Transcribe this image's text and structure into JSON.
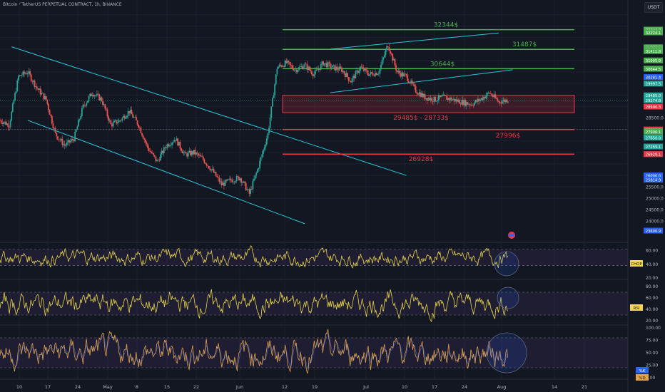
{
  "header": {
    "title": "Bitcoin / TetherUS PERPETUAL CONTRACT, 1h, BINANCE",
    "currency_button": "USDT"
  },
  "colors": {
    "background": "#131722",
    "green_level": "#4caf50",
    "red_level": "#f23645",
    "channel": "#26c6da",
    "indicator_line": "#e6d44a",
    "axis_text": "#b2b5be"
  },
  "chart_data": [
    {
      "type": "line",
      "panel": "price",
      "price_axis": {
        "ylim": [
          23400,
          33200
        ],
        "ticks": [
          25000,
          25500,
          26000,
          26500,
          27000,
          27500,
          28000,
          28500,
          29000,
          29500,
          30000,
          30500,
          31000,
          31500,
          32000,
          32500,
          33000
        ],
        "tick_labels_shown": [
          "28500.0",
          "25500.0",
          "25000.0",
          "24500.0",
          "24000.0"
        ]
      },
      "price_tags": [
        {
          "value": "32344.7",
          "color": "#4caf50"
        },
        {
          "value": "32344.7",
          "color": "#4caf50"
        },
        {
          "value": "32224.1",
          "color": "#4caf50"
        },
        {
          "value": "31577.3",
          "color": "#4caf50"
        },
        {
          "value": "31487.0",
          "color": "#4caf50"
        },
        {
          "value": "31487.0",
          "color": "#4caf50"
        },
        {
          "value": "31411.8",
          "color": "#4caf50"
        },
        {
          "value": "31005.9",
          "color": "#4caf50"
        },
        {
          "value": "30644.5",
          "color": "#4caf50"
        },
        {
          "value": "30644.5",
          "color": "#4caf50"
        },
        {
          "value": "30281.4",
          "color": "#2962ff"
        },
        {
          "value": "29997.5",
          "color": "#26a69a"
        },
        {
          "value": "29485.0",
          "color": "#26a69a"
        },
        {
          "value": "29274.8",
          "color": "#26a69a"
        },
        {
          "value": "28996.3",
          "color": "#f23645"
        },
        {
          "value": "27996.3",
          "color": "#f23645"
        },
        {
          "value": "27996.3",
          "color": "#f23645"
        },
        {
          "value": "27921.1",
          "color": "#4caf50"
        },
        {
          "value": "27906.1",
          "color": "#4caf50"
        },
        {
          "value": "27650.0",
          "color": "#26a69a"
        },
        {
          "value": "27259.1",
          "color": "#26a69a"
        },
        {
          "value": "26928.1",
          "color": "#f23645"
        },
        {
          "value": "26928.1",
          "color": "#f23645"
        },
        {
          "value": "26000.0",
          "color": "#2962ff"
        },
        {
          "value": "25814.9",
          "color": "#2962ff"
        },
        {
          "value": "23600.9",
          "color": "#2962ff"
        }
      ],
      "levels": [
        {
          "price": 32344,
          "label": "32344$",
          "color": "#4caf50"
        },
        {
          "price": 31487,
          "label": "31487$",
          "color": "#4caf50"
        },
        {
          "price": 30644,
          "label": "30644$",
          "color": "#4caf50"
        },
        {
          "price": 27996,
          "label": "27996$",
          "color": "#f23645"
        },
        {
          "price": 26928,
          "label": "26928$",
          "color": "#f23645"
        }
      ],
      "zone": {
        "high": 29485,
        "low": 28733,
        "label": "29485$ - 28733$"
      },
      "x_axis": {
        "labels": [
          "10",
          "17",
          "24",
          "May",
          "8",
          "15",
          "22",
          "Jun",
          "12",
          "19",
          "Jul",
          "10",
          "17",
          "24",
          "Aug",
          "14",
          "21"
        ]
      },
      "series": [
        {
          "x": [
            0,
            4,
            8,
            12,
            16,
            20,
            24,
            28,
            32,
            36,
            40,
            44,
            48,
            52,
            56,
            60,
            64,
            68,
            72,
            76,
            80,
            84,
            88,
            92,
            96,
            100,
            104,
            108,
            112,
            116,
            120,
            124
          ],
          "values": [
            28400,
            28200,
            30300,
            30500,
            29800,
            29300,
            27800,
            27300,
            27600,
            29000,
            29600,
            29300,
            28200,
            28400,
            28800,
            28200,
            27200,
            26600,
            27300,
            27600,
            26900,
            27000,
            26700,
            26200,
            25600,
            25800,
            25900,
            25200,
            26400,
            27800,
            30700,
            30900
          ]
        },
        {
          "x": [
            124,
            128,
            132,
            136,
            140,
            144,
            148,
            152,
            156,
            160,
            164,
            168,
            172,
            176,
            180,
            184,
            188,
            192,
            196,
            200,
            204,
            208,
            212,
            216,
            220
          ],
          "values": [
            30900,
            30600,
            30800,
            30400,
            30900,
            30700,
            30600,
            30100,
            30700,
            30400,
            30500,
            31700,
            30500,
            30300,
            29700,
            29400,
            29300,
            29400,
            29300,
            29200,
            29100,
            29300,
            29600,
            29200,
            29300
          ]
        }
      ]
    },
    {
      "type": "line",
      "panel": "CHOP",
      "badge": "CHOP",
      "ticks": [
        "60.00",
        "40.00",
        "20.00"
      ],
      "ylim": [
        20,
        70
      ],
      "bands": [
        61.8,
        38.2
      ]
    },
    {
      "type": "line",
      "panel": "RSI",
      "badge": "RSI",
      "ticks": [
        "80.00",
        "60.00",
        "40.00",
        "20.00"
      ],
      "ylim": [
        15,
        90
      ],
      "bands": [
        70,
        30
      ]
    },
    {
      "type": "line",
      "panel": "Stoch",
      "badges": [
        "%K",
        "%D"
      ],
      "ticks": [
        "100.00",
        "75.00",
        "50.00",
        "25.00",
        "0.00"
      ],
      "ylim": [
        0,
        100
      ],
      "bands": [
        80,
        20
      ]
    }
  ]
}
